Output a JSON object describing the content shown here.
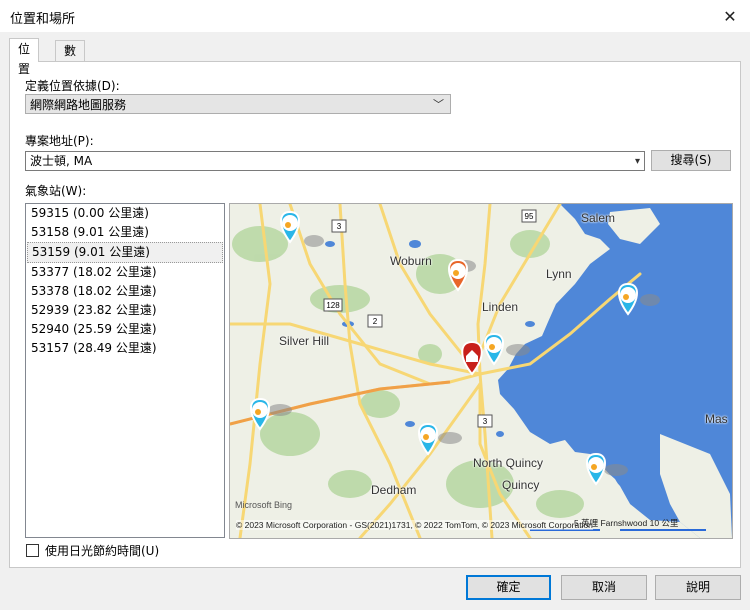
{
  "window": {
    "title": "位置和場所",
    "close_glyph": "✕"
  },
  "tabs": [
    {
      "label": "位置",
      "active": true
    },
    {
      "label": "數地",
      "active": false
    }
  ],
  "location_source": {
    "label": "定義位置依據(D):",
    "value": "網際網路地圖服務"
  },
  "address": {
    "label": "專案地址(P):",
    "value": "波士頓, MA",
    "search_button": "搜尋(S)"
  },
  "stations": {
    "label": "氣象站(W):",
    "items": [
      "59315 (0.00 公里遠)",
      "53158 (9.01 公里遠)",
      "53159 (9.01 公里遠)",
      "53377 (18.02 公里遠)",
      "53378 (18.02 公里遠)",
      "52939 (23.82 公里遠)",
      "52940 (25.59 公里遠)",
      "53157 (28.49 公里遠)"
    ],
    "selected_index": 2
  },
  "map": {
    "places": [
      "Salem",
      "Woburn",
      "Lynn",
      "Linden",
      "Silver Hill",
      "North Quincy",
      "Quincy",
      "Dedham",
      "Mas"
    ],
    "road_shields": [
      "3",
      "95",
      "128",
      "2",
      "3"
    ],
    "attribution": "© 2023 Microsoft Corporation - GS(2021)1731, © 2022 TomTom, © 2023 Microsoft Corporation",
    "brand": "Microsoft Bing",
    "scale_text": "5 英哩 Farnshwood 10 公里",
    "colors": {
      "water": "#4f87d8",
      "land": "#eef0e6",
      "road": "#f7d774",
      "park": "#b9d8a5",
      "pin_blue": "#29b6e8",
      "pin_orange": "#e8662a",
      "pin_home": "#c8201a"
    }
  },
  "daylight_saving": {
    "label": "使用日光節約時間(U)",
    "checked": false
  },
  "buttons": {
    "ok": "確定",
    "cancel": "取消",
    "help": "說明"
  }
}
